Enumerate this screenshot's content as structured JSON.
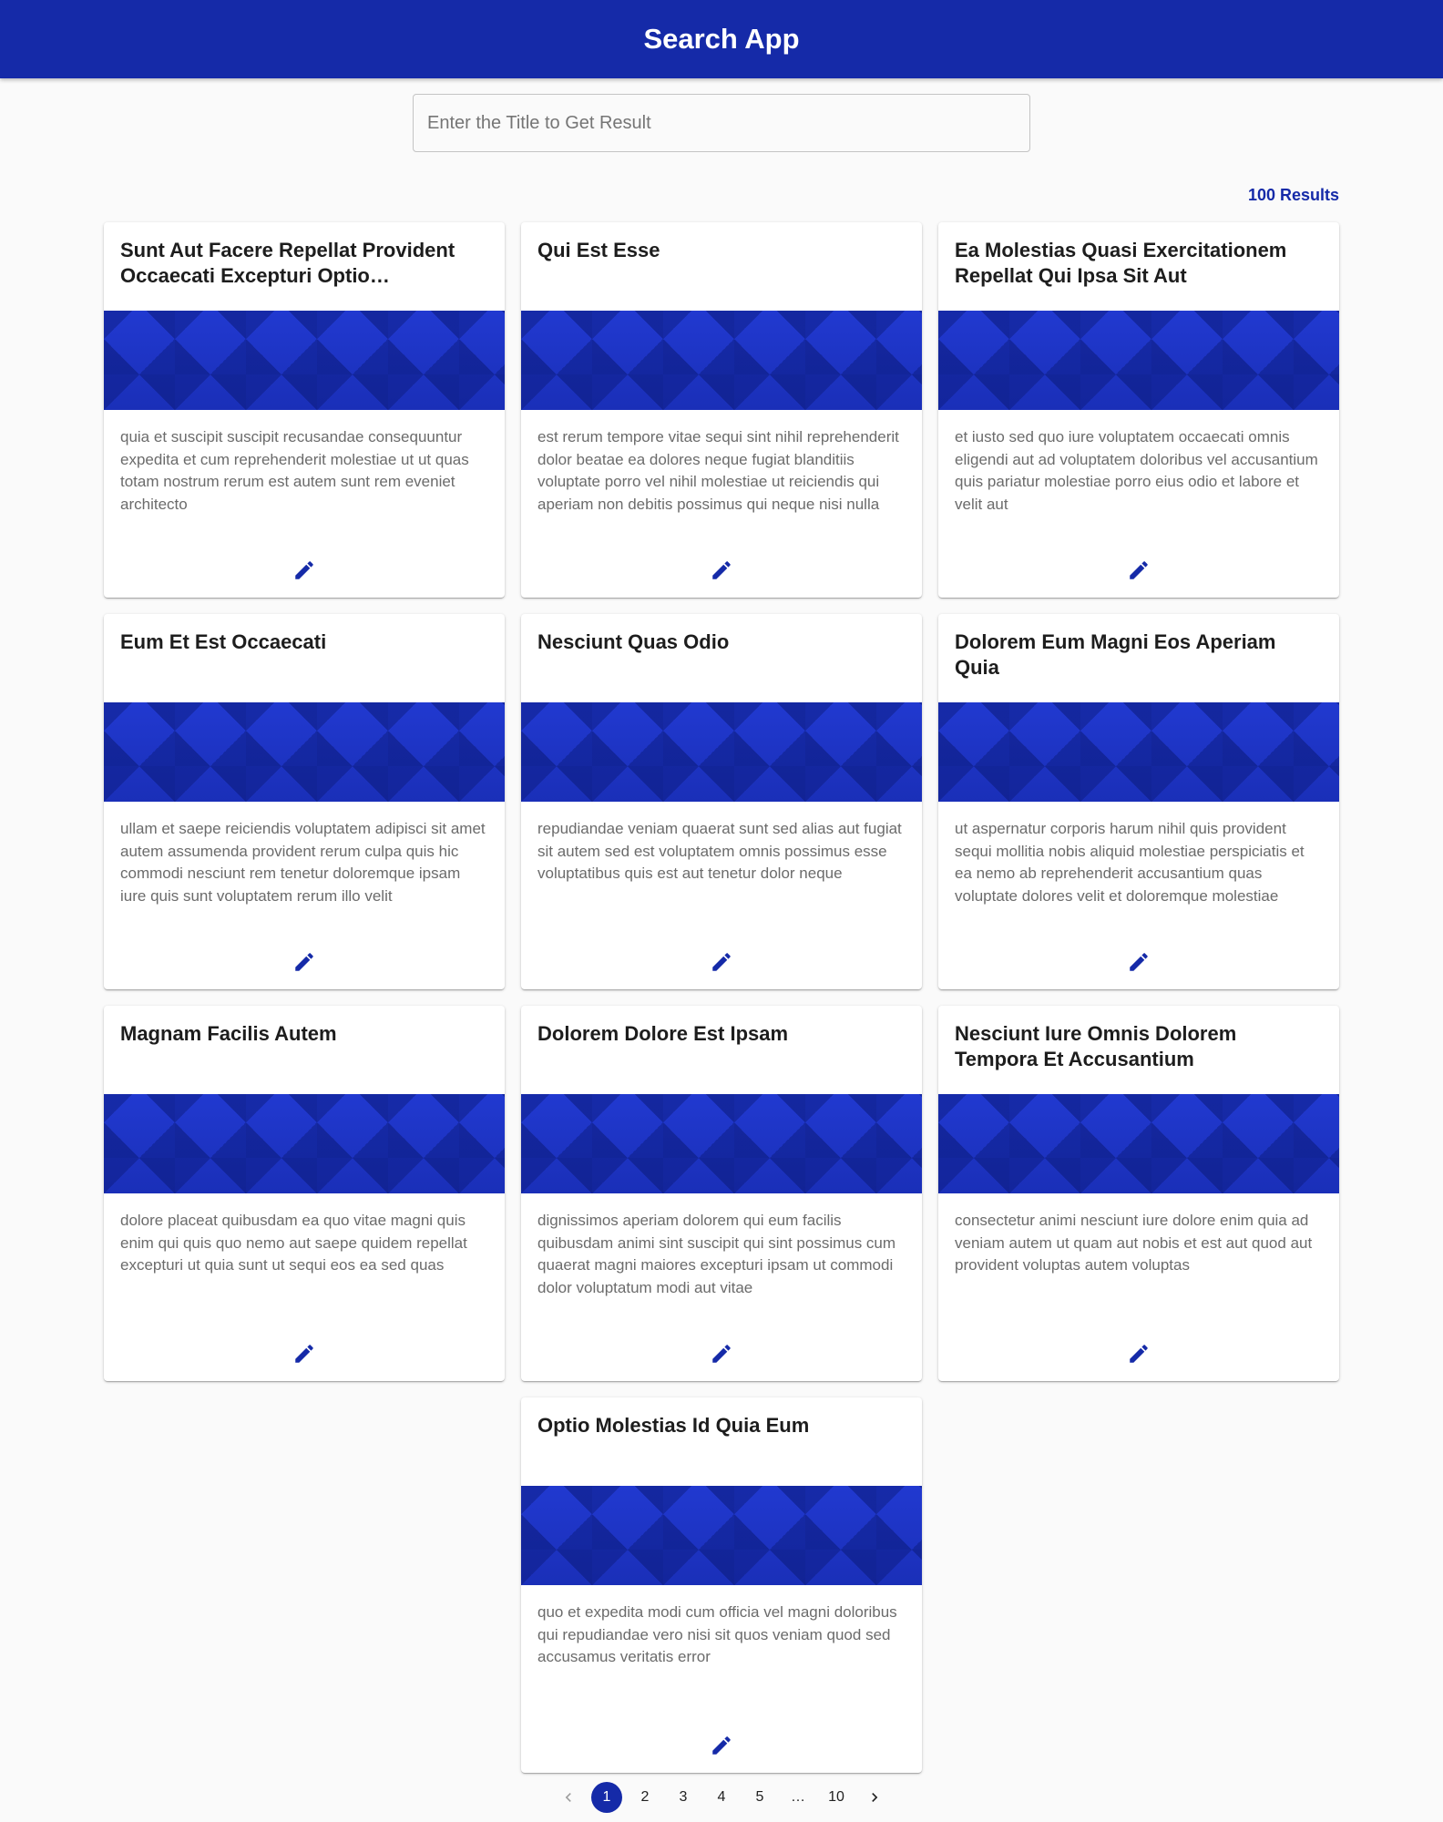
{
  "app_bar": {
    "title": "Search App"
  },
  "search": {
    "placeholder": "Enter the Title to Get Result",
    "value": ""
  },
  "results": {
    "count_label": "100 Results"
  },
  "cards": [
    {
      "title": "Sunt Aut Facere Repellat Provident Occaecati Excepturi Optio…",
      "body": "quia et suscipit suscipit recusandae consequuntur expedita et cum reprehenderit molestiae ut ut quas totam nostrum rerum est autem sunt rem eveniet architecto"
    },
    {
      "title": "Qui Est Esse",
      "body": "est rerum tempore vitae sequi sint nihil reprehenderit dolor beatae ea dolores neque fugiat blanditiis voluptate porro vel nihil molestiae ut reiciendis qui aperiam non debitis possimus qui neque nisi nulla"
    },
    {
      "title": "Ea Molestias Quasi Exercitationem Repellat Qui Ipsa Sit Aut",
      "body": "et iusto sed quo iure voluptatem occaecati omnis eligendi aut ad voluptatem doloribus vel accusantium quis pariatur molestiae porro eius odio et labore et velit aut"
    },
    {
      "title": "Eum Et Est Occaecati",
      "body": "ullam et saepe reiciendis voluptatem adipisci sit amet autem assumenda provident rerum culpa quis hic commodi nesciunt rem tenetur doloremque ipsam iure quis sunt voluptatem rerum illo velit"
    },
    {
      "title": "Nesciunt Quas Odio",
      "body": "repudiandae veniam quaerat sunt sed alias aut fugiat sit autem sed est voluptatem omnis possimus esse voluptatibus quis est aut tenetur dolor neque"
    },
    {
      "title": "Dolorem Eum Magni Eos Aperiam Quia",
      "body": "ut aspernatur corporis harum nihil quis provident sequi mollitia nobis aliquid molestiae perspiciatis et ea nemo ab reprehenderit accusantium quas voluptate dolores velit et doloremque molestiae"
    },
    {
      "title": "Magnam Facilis Autem",
      "body": "dolore placeat quibusdam ea quo vitae magni quis enim qui quis quo nemo aut saepe quidem repellat excepturi ut quia sunt ut sequi eos ea sed quas"
    },
    {
      "title": "Dolorem Dolore Est Ipsam",
      "body": "dignissimos aperiam dolorem qui eum facilis quibusdam animi sint suscipit qui sint possimus cum quaerat magni maiores excepturi ipsam ut commodi dolor voluptatum modi aut vitae"
    },
    {
      "title": "Nesciunt Iure Omnis Dolorem Tempora Et Accusantium",
      "body": "consectetur animi nesciunt iure dolore enim quia ad veniam autem ut quam aut nobis et est aut quod aut provident voluptas autem voluptas"
    },
    {
      "title": "Optio Molestias Id Quia Eum",
      "body": "quo et expedita modi cum officia vel magni doloribus qui repudiandae vero nisi sit quos veniam quod sed accusamus veritatis error"
    }
  ],
  "icons": {
    "edit": "pencil-icon",
    "prev": "chevron-left-icon",
    "next": "chevron-right-icon"
  },
  "colors": {
    "primary": "#152aa8",
    "background": "#fafafa"
  },
  "pagination": {
    "pages": [
      "1",
      "2",
      "3",
      "4",
      "5"
    ],
    "ellipsis": "…",
    "last": "10",
    "selected": "1"
  }
}
